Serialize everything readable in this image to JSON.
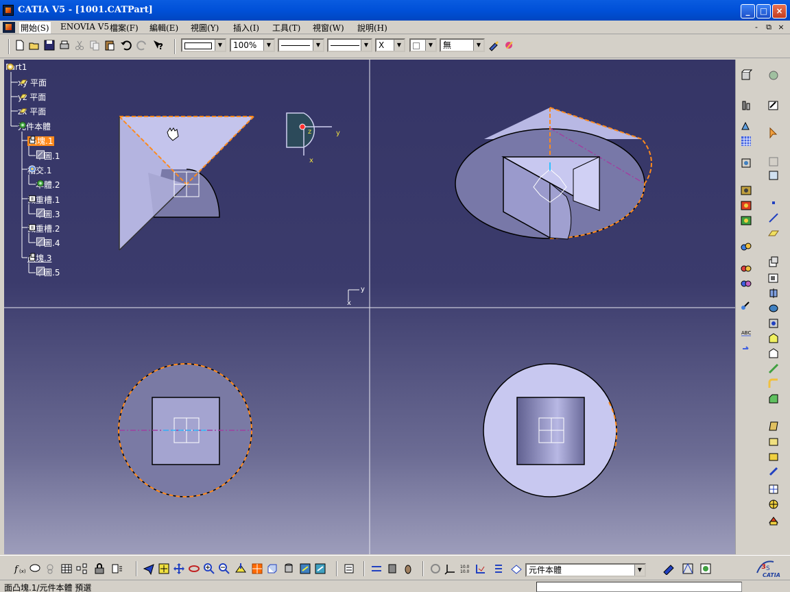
{
  "window": {
    "title": "CATIA V5 - [1001.CATPart]",
    "controls": {
      "minimize": "_",
      "maximize": "□",
      "close": "×"
    }
  },
  "menu": {
    "items": [
      "開始(S)",
      "ENOVIA V5",
      "檔案(F)",
      "編輯(E)",
      "視圖(Y)",
      "插入(I)",
      "工具(T)",
      "視窗(W)",
      "說明(H)"
    ],
    "mdi_controls": [
      "-",
      "⧉",
      "×"
    ]
  },
  "toolbar": {
    "zoom_value": "100%",
    "layer_value": "無",
    "linetype_value": "X"
  },
  "tree": {
    "root": "Part1",
    "items": [
      {
        "label": "xy 平面"
      },
      {
        "label": "yz 平面"
      },
      {
        "label": "zx 平面"
      },
      {
        "label": "元件本體"
      },
      {
        "label": "凸塊.1"
      },
      {
        "label": "草圖.1"
      },
      {
        "label": "相交.1"
      },
      {
        "label": "本體.2"
      },
      {
        "label": "減重槽.1"
      },
      {
        "label": "草圖.3"
      },
      {
        "label": "減重槽.2"
      },
      {
        "label": "草圖.4"
      },
      {
        "label": "凸塊.3"
      },
      {
        "label": "草圖.5"
      }
    ]
  },
  "viewport": {
    "compass_labels": {
      "z": "z",
      "y": "y",
      "x": "x"
    },
    "axis_labels": {
      "y": "y",
      "x": "x"
    }
  },
  "bottom_toolbar": {
    "current_body": "元件本體"
  },
  "status": {
    "text": "面凸塊.1/元件本體 預選"
  },
  "logo": {
    "brand": "CATIA"
  },
  "colors": {
    "titlebar": "#0050d8",
    "viewport_top": "#353566",
    "viewport_bottom": "#9d9dbb",
    "selection_orange": "#ff8a1c",
    "face_lavender": "#c0c0e8"
  }
}
